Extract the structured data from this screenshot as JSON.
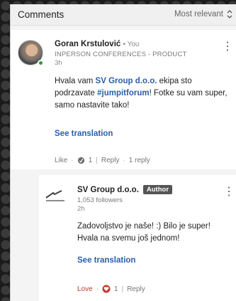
{
  "header": {
    "title": "Comments",
    "sort_label": "Most relevant"
  },
  "comment": {
    "author": "Goran Krstulović",
    "you_tag": "• You",
    "headline": "INPERSON CONFERENCES - PRODUCT",
    "time": "3h",
    "body_prefix": "Hvala vam ",
    "mention": "SV Group d.o.o.",
    "body_middle": " ekipa sto podrzavate ",
    "hashtag": "#jumpitforum",
    "body_suffix": "! Fotke su vam super, samo nastavite tako!",
    "see_translation": "See translation",
    "actions": {
      "like": "Like",
      "reaction_count": "1",
      "reply": "Reply",
      "reply_count": "1 reply"
    }
  },
  "reply": {
    "author": "SV Group d.o.o.",
    "badge": "Author",
    "followers": "1,053 followers",
    "time": "2h",
    "body": "Zadovoljstvo je naše! :) Bilo je super! Hvala na svemu još jednom!",
    "see_translation": "See translation",
    "actions": {
      "love": "Love",
      "reaction_count": "1",
      "reply": "Reply"
    }
  },
  "colors": {
    "link": "#2a5fa8",
    "love": "#c0392b",
    "online": "#2e9a3e"
  },
  "icons": [
    "sort-arrows-icon",
    "more-options-icon",
    "clap-reaction-icon",
    "heart-reaction-icon",
    "company-logo-icon"
  ]
}
